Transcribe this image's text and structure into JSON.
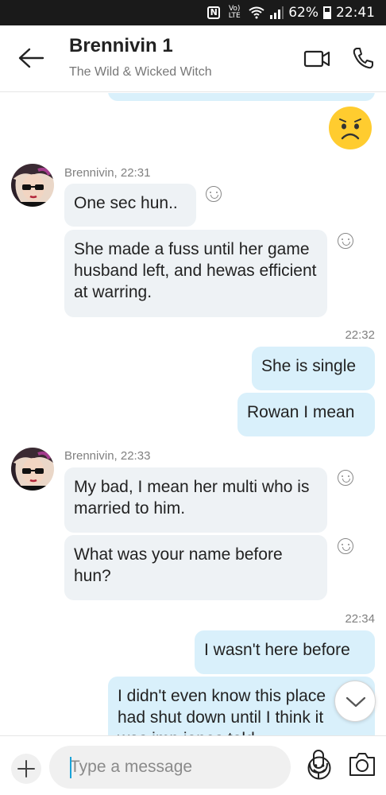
{
  "status_bar": {
    "nfc": "N",
    "network": "Vo) LTE",
    "battery": "62%",
    "time": "22:41"
  },
  "header": {
    "title": "Brennivin 1",
    "subtitle": "The Wild & Wicked Witch"
  },
  "messages": [
    {
      "kind": "sender",
      "text": "Brennivin, 22:31"
    },
    {
      "kind": "incoming",
      "text": "One sec hun.."
    },
    {
      "kind": "incoming",
      "text": "She made a fuss until her game husband left, and hewas efficient at warring."
    },
    {
      "kind": "time",
      "text": "22:32"
    },
    {
      "kind": "outgoing",
      "text": "She is single"
    },
    {
      "kind": "outgoing",
      "text": "Rowan I mean"
    },
    {
      "kind": "sender",
      "text": "Brennivin, 22:33"
    },
    {
      "kind": "incoming",
      "text": "My bad, I mean her multi who is married to him."
    },
    {
      "kind": "incoming",
      "text": "What was your name before hun?"
    },
    {
      "kind": "time",
      "text": "22:34"
    },
    {
      "kind": "outgoing",
      "text": "I wasn't here before"
    },
    {
      "kind": "outgoing",
      "text": "I didn't even know this place had shut down until I think it was imp jones told"
    }
  ],
  "composer": {
    "placeholder": "Type a message"
  },
  "colors": {
    "incoming_bubble": "#eef2f5",
    "outgoing_bubble": "#d9f0fb",
    "accent": "#1aa3d8",
    "emoji_yellow": "#ffcc2f"
  },
  "icons": [
    "back-arrow-icon",
    "video-call-icon",
    "phone-icon",
    "worried-emoji",
    "add-reaction-icon",
    "chevron-down-icon",
    "plus-icon",
    "emoji-icon",
    "microphone-icon",
    "camera-icon"
  ]
}
